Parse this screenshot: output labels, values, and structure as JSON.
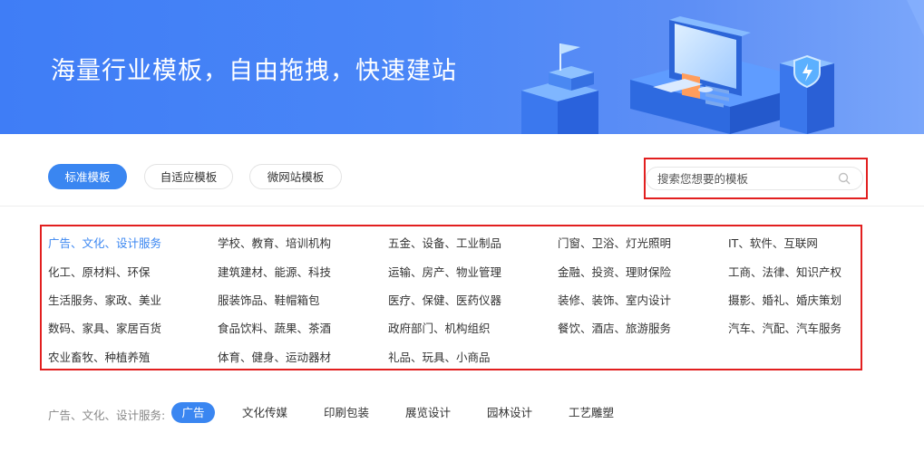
{
  "banner": {
    "title": "海量行业模板，自由拖拽，快速建站"
  },
  "tabs": [
    {
      "label": "标准模板",
      "active": true
    },
    {
      "label": "自适应模板",
      "active": false
    },
    {
      "label": "微网站模板",
      "active": false
    }
  ],
  "search": {
    "placeholder": "搜索您想要的模板"
  },
  "categories": [
    [
      "广告、文化、设计服务",
      "学校、教育、培训机构",
      "五金、设备、工业制品",
      "门窗、卫浴、灯光照明",
      "IT、软件、互联网"
    ],
    [
      "化工、原材料、环保",
      "建筑建材、能源、科技",
      "运输、房产、物业管理",
      "金融、投资、理财保险",
      "工商、法律、知识产权"
    ],
    [
      "生活服务、家政、美业",
      "服装饰品、鞋帽箱包",
      "医疗、保健、医药仪器",
      "装修、装饰、室内设计",
      "摄影、婚礼、婚庆策划"
    ],
    [
      "数码、家具、家居百货",
      "食品饮料、蔬果、茶酒",
      "政府部门、机构组织",
      "餐饮、酒店、旅游服务",
      "汽车、汽配、汽车服务"
    ],
    [
      "农业畜牧、种植养殖",
      "体育、健身、运动器材",
      "礼品、玩具、小商品"
    ]
  ],
  "subcategory": {
    "label": "广告、文化、设计服务:",
    "items": [
      "广告",
      "文化传媒",
      "印刷包装",
      "展览设计",
      "园林设计",
      "工艺雕塑"
    ]
  },
  "colors": {
    "accent": "#3a86f1",
    "highlight_border": "#e21f1f",
    "banner": "#4a86f7"
  }
}
